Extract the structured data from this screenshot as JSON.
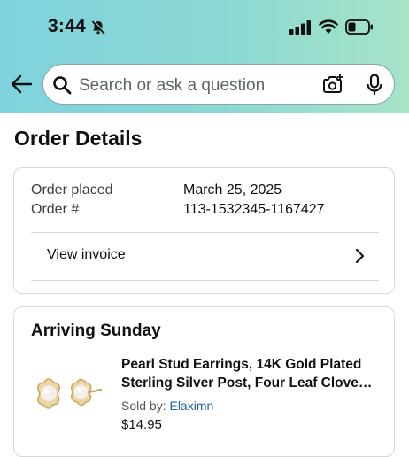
{
  "status_bar": {
    "time": "3:44"
  },
  "search": {
    "placeholder": "Search or ask a question"
  },
  "page": {
    "title": "Order Details"
  },
  "order_info": {
    "placed_label": "Order placed",
    "placed_value": "March 25, 2025",
    "number_label": "Order #",
    "number_value": "113-1532345-1167427",
    "invoice_label": "View invoice"
  },
  "shipment": {
    "heading": "Arriving Sunday",
    "product_title": "Pearl Stud Earrings, 14K Gold Plated Sterling Silver Post, Four Leaf Clove…",
    "sold_by_label": "Sold by:",
    "seller": "Elaximn",
    "price": "$14.95"
  },
  "colors": {
    "header_gradient_start": "#7fd3dd",
    "header_gradient_end": "#a7e4c8",
    "link": "#2162a1",
    "border": "#d5d9d9"
  },
  "icons": [
    "bell-slash-icon",
    "signal-icon",
    "wifi-icon",
    "battery-icon",
    "back-arrow-icon",
    "search-icon",
    "camera-icon",
    "microphone-icon",
    "chevron-right-icon"
  ]
}
